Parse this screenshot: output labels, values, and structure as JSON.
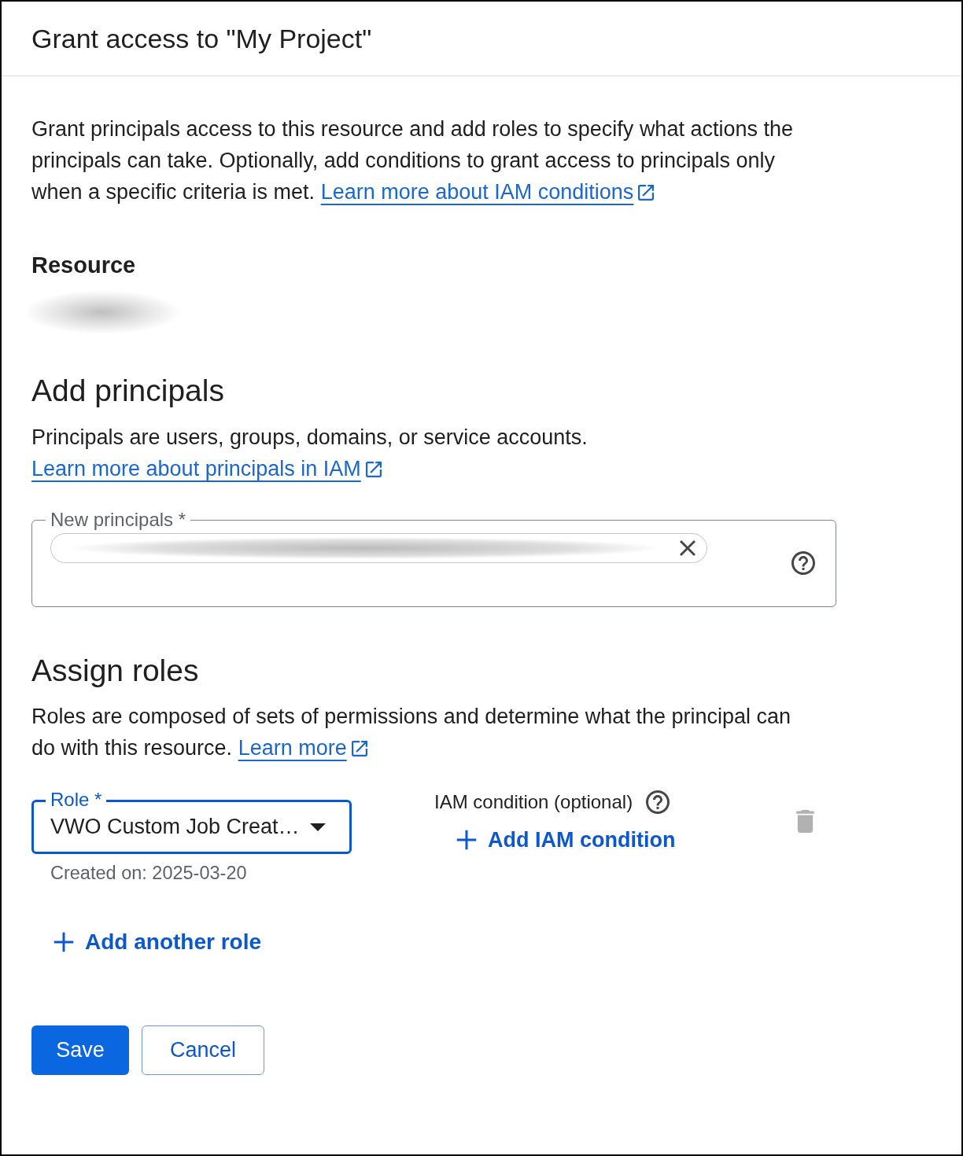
{
  "dialog": {
    "title": "Grant access to \"My Project\""
  },
  "intro": {
    "text": "Grant principals access to this resource and add roles to specify what actions the principals can take. Optionally, add conditions to grant access to principals only when a specific criteria is met.",
    "link": "Learn more about IAM conditions"
  },
  "resource": {
    "heading": "Resource",
    "value_blurred": true
  },
  "principals": {
    "heading": "Add principals",
    "text": "Principals are users, groups, domains, or service accounts.",
    "link": "Learn more about principals in IAM",
    "field": {
      "label": "New principals *",
      "chips": [
        {
          "text_blurred": true
        }
      ]
    }
  },
  "roles": {
    "heading": "Assign roles",
    "text": "Roles are composed of sets of permissions and determine what the principal can do with this resource.",
    "link": "Learn more",
    "rows": [
      {
        "role_label": "Role *",
        "role_value": "VWO Custom Job Creat…",
        "focused": true,
        "hint": "Created on: 2025-03-20",
        "condition_label": "IAM condition (optional)",
        "condition_button": "Add IAM condition",
        "delete_disabled": true
      }
    ],
    "add_button": "Add another role"
  },
  "buttons": [
    {
      "label": "Save",
      "kind": "primary"
    },
    {
      "label": "Cancel",
      "kind": "secondary"
    }
  ]
}
